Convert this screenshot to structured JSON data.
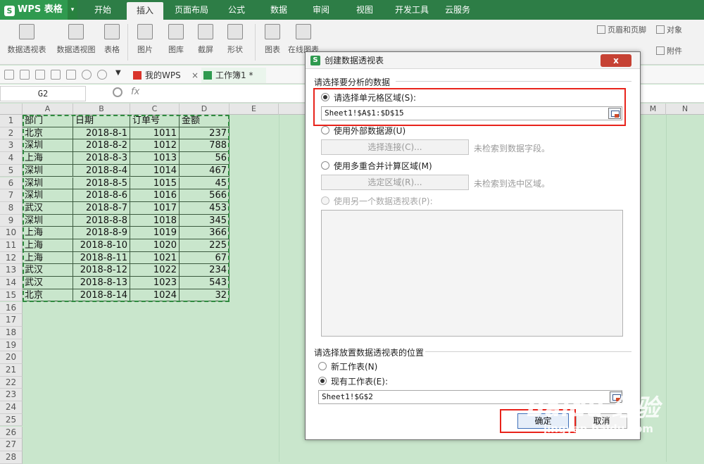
{
  "app": {
    "name": "WPS 表格",
    "logo_letter": "S"
  },
  "menu_tabs": [
    "开始",
    "插入",
    "页面布局",
    "公式",
    "数据",
    "审阅",
    "视图",
    "开发工具",
    "云服务"
  ],
  "ribbon": {
    "items": [
      "数据透视表",
      "数据透视图",
      "表格",
      "图片",
      "图库",
      "截屏",
      "形状",
      "图表",
      "在线图表"
    ],
    "right_items": [
      "页眉和页脚",
      "对象",
      "附件"
    ]
  },
  "doc_tabs": {
    "wps": "我的WPS",
    "workbook": "工作簿1 *",
    "close": "×"
  },
  "formula_bar": {
    "name_box": "G2",
    "fx": "fx"
  },
  "sheet": {
    "columns": [
      "A",
      "B",
      "C",
      "D",
      "E",
      "M",
      "N"
    ],
    "row_numbers": [
      "1",
      "2",
      "3",
      "4",
      "5",
      "6",
      "7",
      "8",
      "9",
      "10",
      "11",
      "12",
      "13",
      "14",
      "15",
      "16",
      "17",
      "18",
      "19",
      "20",
      "21",
      "22",
      "23",
      "24",
      "25",
      "26",
      "27",
      "28"
    ],
    "headers": [
      "部门",
      "日期",
      "订单号",
      "金额"
    ],
    "rows": [
      [
        "北京",
        "2018-8-1",
        "1011",
        "237"
      ],
      [
        "深圳",
        "2018-8-2",
        "1012",
        "788"
      ],
      [
        "上海",
        "2018-8-3",
        "1013",
        "56"
      ],
      [
        "深圳",
        "2018-8-4",
        "1014",
        "467"
      ],
      [
        "深圳",
        "2018-8-5",
        "1015",
        "45"
      ],
      [
        "深圳",
        "2018-8-6",
        "1016",
        "566"
      ],
      [
        "武汉",
        "2018-8-7",
        "1017",
        "453"
      ],
      [
        "深圳",
        "2018-8-8",
        "1018",
        "345"
      ],
      [
        "上海",
        "2018-8-9",
        "1019",
        "366"
      ],
      [
        "上海",
        "2018-8-10",
        "1020",
        "225"
      ],
      [
        "上海",
        "2018-8-11",
        "1021",
        "67"
      ],
      [
        "武汉",
        "2018-8-12",
        "1022",
        "234"
      ],
      [
        "武汉",
        "2018-8-13",
        "1023",
        "543"
      ],
      [
        "北京",
        "2018-8-14",
        "1024",
        "32"
      ]
    ]
  },
  "dialog": {
    "title": "创建数据透视表",
    "close": "x",
    "section_source": "请选择要分析的数据",
    "opt_range": "请选择单元格区域(S):",
    "range_value": "Sheet1!$A$1:$D$15",
    "opt_external": "使用外部数据源(U)",
    "btn_connect": "选择连接(C)...",
    "hint_connect": "未检索到数据字段。",
    "opt_consolidate": "使用多重合并计算区域(M)",
    "btn_select_region": "选定区域(R)...",
    "hint_region": "未检索到选中区域。",
    "opt_other_pivot": "使用另一个数据透视表(P):",
    "section_location": "请选择放置数据透视表的位置",
    "opt_new_sheet": "新工作表(N)",
    "opt_existing_sheet": "现有工作表(E):",
    "location_value": "Sheet1!$G$2",
    "ok": "确定",
    "cancel": "取消"
  },
  "watermark": {
    "brand": "Baidu 经验",
    "url": "jingyan.baidu.com"
  },
  "colors": {
    "tabbar": "#2d7d46",
    "grid_bg": "#c9e6cc",
    "highlight": "#e8231b",
    "accent": "#2f9a4f"
  }
}
